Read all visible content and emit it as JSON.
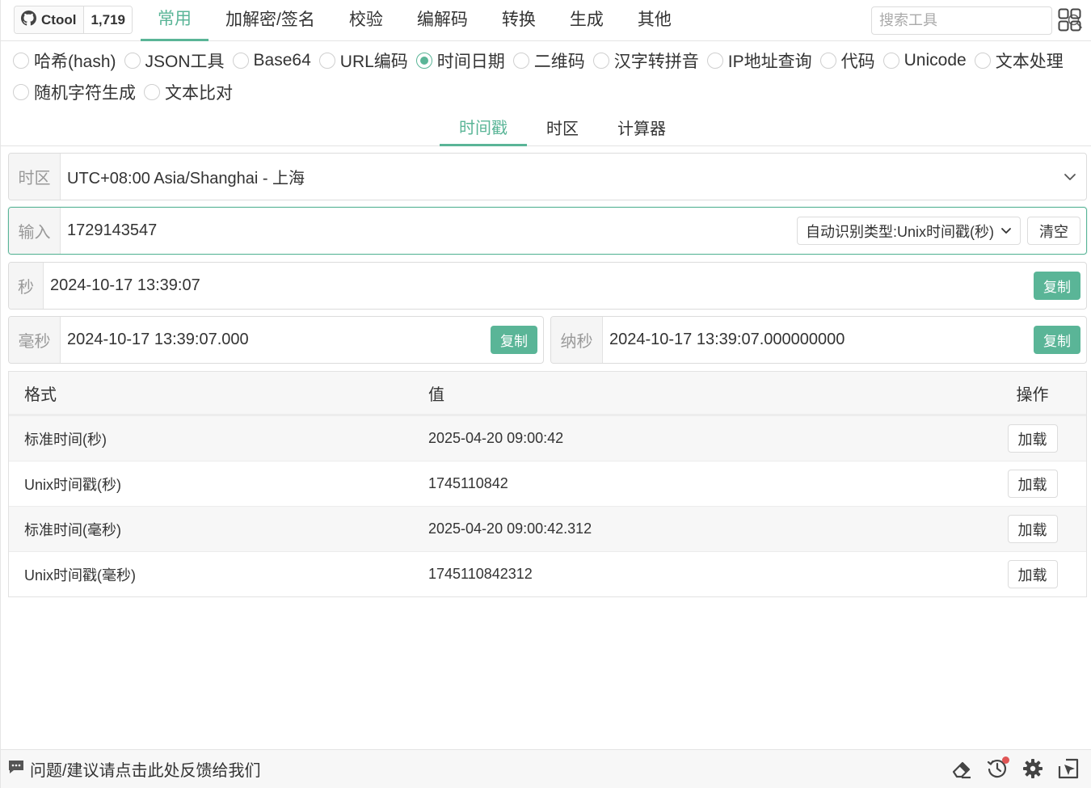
{
  "brand": {
    "name": "Ctool",
    "count": "1,719",
    "icon": "github-icon"
  },
  "nav": {
    "items": [
      {
        "label": "常用",
        "active": true
      },
      {
        "label": "加解密/签名",
        "active": false
      },
      {
        "label": "校验",
        "active": false
      },
      {
        "label": "编解码",
        "active": false
      },
      {
        "label": "转换",
        "active": false
      },
      {
        "label": "生成",
        "active": false
      },
      {
        "label": "其他",
        "active": false
      }
    ]
  },
  "search": {
    "placeholder": "搜索工具",
    "value": ""
  },
  "tools": [
    {
      "label": "哈希(hash)",
      "checked": false
    },
    {
      "label": "JSON工具",
      "checked": false
    },
    {
      "label": "Base64",
      "checked": false
    },
    {
      "label": "URL编码",
      "checked": false
    },
    {
      "label": "时间日期",
      "checked": true
    },
    {
      "label": "二维码",
      "checked": false
    },
    {
      "label": "汉字转拼音",
      "checked": false
    },
    {
      "label": "IP地址查询",
      "checked": false
    },
    {
      "label": "代码",
      "checked": false
    },
    {
      "label": "Unicode",
      "checked": false
    },
    {
      "label": "文本处理",
      "checked": false
    },
    {
      "label": "随机字符生成",
      "checked": false
    },
    {
      "label": "文本比对",
      "checked": false
    }
  ],
  "subtabs": [
    {
      "label": "时间戳",
      "active": true
    },
    {
      "label": "时区",
      "active": false
    },
    {
      "label": "计算器",
      "active": false
    }
  ],
  "timezone": {
    "label": "时区",
    "value": "UTC+08:00 Asia/Shanghai - 上海"
  },
  "input": {
    "label": "输入",
    "value": "1729143547",
    "type_label": "自动识别类型:Unix时间戳(秒)",
    "clear_label": "清空"
  },
  "outputs": {
    "copy_label": "复制",
    "seconds": {
      "label": "秒",
      "value": "2024-10-17 13:39:07"
    },
    "millis": {
      "label": "毫秒",
      "value": "2024-10-17 13:39:07.000"
    },
    "nanos": {
      "label": "纳秒",
      "value": "2024-10-17 13:39:07.000000000"
    }
  },
  "table": {
    "headers": {
      "format": "格式",
      "value": "值",
      "action": "操作"
    },
    "load_label": "加载",
    "rows": [
      {
        "format": "标准时间(秒)",
        "value": "2025-04-20 09:00:42"
      },
      {
        "format": "Unix时间戳(秒)",
        "value": "1745110842"
      },
      {
        "format": "标准时间(毫秒)",
        "value": "2025-04-20 09:00:42.312"
      },
      {
        "format": "Unix时间戳(毫秒)",
        "value": "1745110842312"
      }
    ]
  },
  "footer": {
    "feedback": "问题/建议请点击此处反馈给我们"
  },
  "colors": {
    "accent": "#5ab597",
    "notice": "#e05555"
  }
}
